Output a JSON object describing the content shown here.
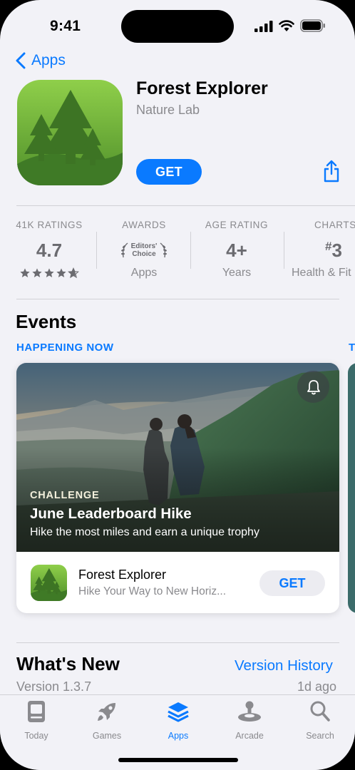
{
  "status": {
    "time": "9:41"
  },
  "nav": {
    "back_label": "Apps"
  },
  "app": {
    "name": "Forest Explorer",
    "developer": "Nature Lab",
    "get_label": "GET",
    "icon": "pine-trees-icon"
  },
  "stats": [
    {
      "label": "41K RATINGS",
      "value": "4.7",
      "rating_stars": 4.7
    },
    {
      "label": "AWARDS",
      "value_line1": "Editors'",
      "value_line2": "Choice",
      "sub": "Apps"
    },
    {
      "label": "AGE RATING",
      "value": "4+",
      "sub": "Years"
    },
    {
      "label": "CHARTS",
      "value_prefix": "#",
      "value": "3",
      "sub": "Health & Fit"
    }
  ],
  "events": {
    "title": "Events",
    "status": "HAPPENING NOW",
    "next_status": "T",
    "card": {
      "tag": "CHALLENGE",
      "title": "June Leaderboard Hike",
      "description": "Hike the most miles and earn a unique trophy",
      "app_name": "Forest Explorer",
      "app_subtitle": "Hike Your Way to New Horiz...",
      "get_label": "GET"
    }
  },
  "whats_new": {
    "title": "What's New",
    "link": "Version History",
    "version": "Version 1.3.7",
    "ago": "1d ago"
  },
  "tabs": [
    {
      "label": "Today",
      "icon": "today-icon",
      "active": false
    },
    {
      "label": "Games",
      "icon": "rocket-icon",
      "active": false
    },
    {
      "label": "Apps",
      "icon": "layers-icon",
      "active": true
    },
    {
      "label": "Arcade",
      "icon": "joystick-icon",
      "active": false
    },
    {
      "label": "Search",
      "icon": "search-icon",
      "active": false
    }
  ],
  "colors": {
    "accent": "#0a7aff",
    "background": "#f2f2f7",
    "icon_green": "#5a9a2e"
  }
}
